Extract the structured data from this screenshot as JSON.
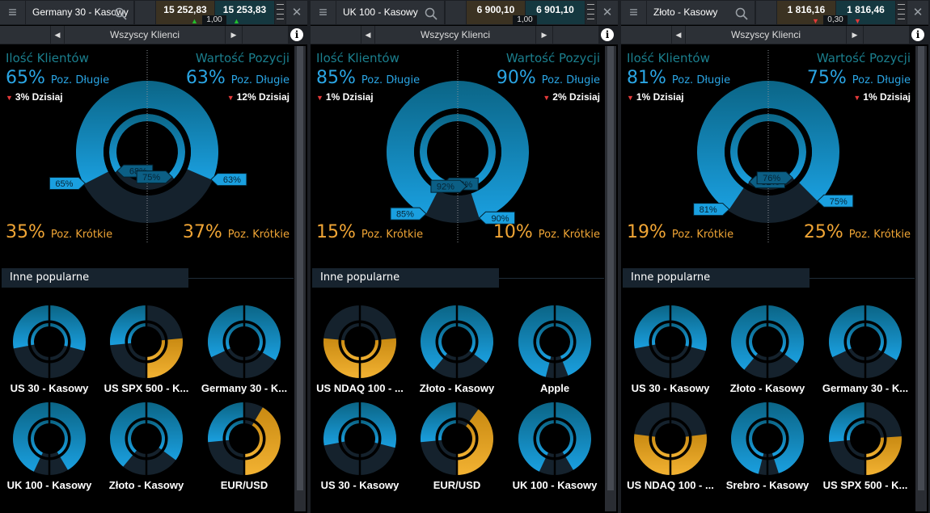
{
  "colors": {
    "long": "#1a9fdf",
    "long_top": "#0b6586",
    "short_orange": "#e8a322",
    "empty": "#15222d",
    "down": "#e53a3a",
    "up": "#22c02e",
    "heading": "#1b7f8e",
    "long_text": "#2aa5e4",
    "short_text": "#f0a535"
  },
  "common": {
    "filter": "Wszyscy Klienci",
    "clients_heading": "Ilość Klientów",
    "value_heading": "Wartość Pozycji",
    "long_label": "Poz. Długie",
    "short_label": "Poz. Krótkie",
    "today_label": "Dzisiaj",
    "popular_heading": "Inne popularne",
    "menu_icon": "hamburger-icon",
    "search_icon": "search-icon",
    "close_icon": "close-icon",
    "info_icon": "info-icon"
  },
  "panels": [
    {
      "instrument": "Germany 30 - Kasowy",
      "sell": "15 252,83",
      "buy": "15 253,83",
      "spread": "1,00",
      "direction": "up",
      "clients": {
        "long": "65%",
        "short": "35%",
        "change": "3%",
        "change_dir": "down"
      },
      "value": {
        "long": "63%",
        "short": "37%",
        "change": "12%",
        "change_dir": "down"
      },
      "chart": {
        "clients_now": 65,
        "clients_prev": 68,
        "value_now": 63,
        "value_prev": 75,
        "labels": {
          "clients_now": "65%",
          "clients_prev": "68%",
          "value_now": "63%",
          "value_prev": "75%"
        }
      },
      "popular": [
        {
          "name": "US 30 - Kasowy",
          "clients_long": 56,
          "value_long": 58
        },
        {
          "name": "US SPX 500 - K...",
          "clients_long": 53,
          "value_long": 47
        },
        {
          "name": "Germany 30 - K...",
          "clients_long": 64,
          "value_long": 67
        },
        {
          "name": "UK 100 - Kasowy",
          "clients_long": 86,
          "value_long": 83
        },
        {
          "name": "Złoto - Kasowy",
          "clients_long": 78,
          "value_long": 70
        },
        {
          "name": "EUR/USD",
          "clients_long": 53,
          "value_long": 17
        }
      ]
    },
    {
      "instrument": "UK 100 - Kasowy",
      "sell": "6 900,10",
      "buy": "6 901,10",
      "spread": "1,00",
      "direction": "none",
      "clients": {
        "long": "85%",
        "short": "15%",
        "change": "1%",
        "change_dir": "down"
      },
      "value": {
        "long": "90%",
        "short": "10%",
        "change": "2%",
        "change_dir": "down"
      },
      "chart": {
        "clients_now": 85,
        "clients_prev": 86,
        "value_now": 90,
        "value_prev": 92,
        "labels": {
          "clients_now": "85%",
          "clients_prev": "86%",
          "value_now": "90%",
          "value_prev": "92%"
        }
      },
      "popular": [
        {
          "name": "US NDAQ 100 - ...",
          "clients_long": 47,
          "value_long": 47
        },
        {
          "name": "Złoto - Kasowy",
          "clients_long": 78,
          "value_long": 70
        },
        {
          "name": "Apple",
          "clients_long": 92,
          "value_long": 88
        },
        {
          "name": "US 30 - Kasowy",
          "clients_long": 56,
          "value_long": 58
        },
        {
          "name": "EUR/USD",
          "clients_long": 53,
          "value_long": 20
        },
        {
          "name": "UK 100 - Kasowy",
          "clients_long": 86,
          "value_long": 83
        }
      ]
    },
    {
      "instrument": "Złoto - Kasowy",
      "sell": "1 816,16",
      "buy": "1 816,46",
      "spread": "0,30",
      "direction": "down",
      "clients": {
        "long": "81%",
        "short": "19%",
        "change": "1%",
        "change_dir": "down"
      },
      "value": {
        "long": "75%",
        "short": "25%",
        "change": "1%",
        "change_dir": "down"
      },
      "chart": {
        "clients_now": 81,
        "clients_prev": 82,
        "value_now": 75,
        "value_prev": 76,
        "labels": {
          "clients_now": "81%",
          "clients_prev": "82%",
          "value_now": "75%",
          "value_prev": "76%"
        }
      },
      "popular": [
        {
          "name": "US 30 - Kasowy",
          "clients_long": 56,
          "value_long": 58
        },
        {
          "name": "Złoto - Kasowy",
          "clients_long": 78,
          "value_long": 70
        },
        {
          "name": "Germany 30 - K...",
          "clients_long": 64,
          "value_long": 67
        },
        {
          "name": "US NDAQ 100 - ...",
          "clients_long": 46,
          "value_long": 46
        },
        {
          "name": "Srebro - Kasowy",
          "clients_long": 92,
          "value_long": 90
        },
        {
          "name": "US SPX 500 - K...",
          "clients_long": 53,
          "value_long": 48
        }
      ]
    }
  ]
}
